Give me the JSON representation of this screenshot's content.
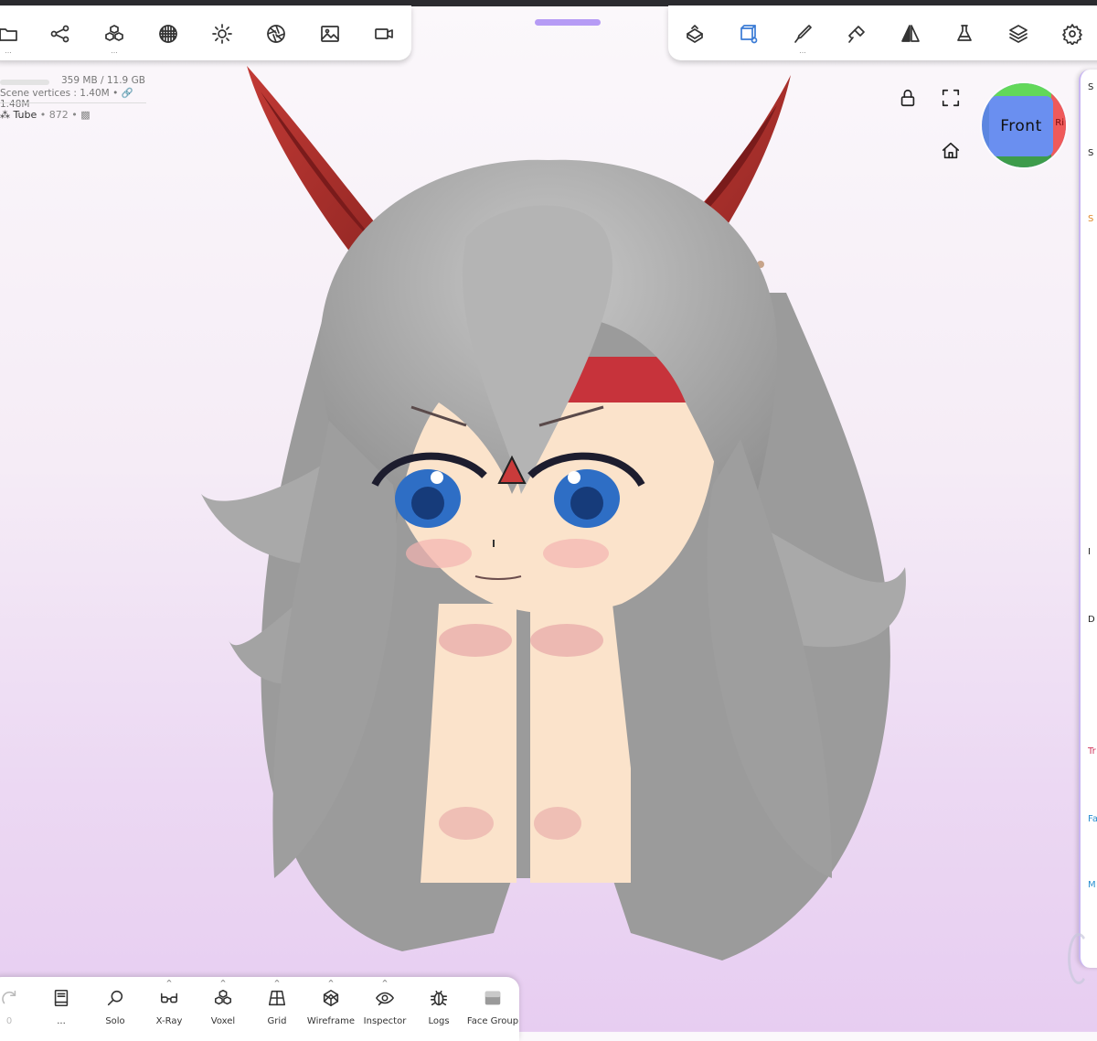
{
  "app": {
    "grabber": "drag-handle"
  },
  "left_toolbar": {
    "tools": [
      {
        "icon": "folder-icon",
        "more": "..."
      },
      {
        "icon": "share-nodes-icon",
        "more": ""
      },
      {
        "icon": "primitives-icon",
        "more": "..."
      },
      {
        "icon": "material-sphere-icon",
        "more": ""
      },
      {
        "icon": "light-icon",
        "more": ""
      },
      {
        "icon": "aperture-icon",
        "more": ""
      },
      {
        "icon": "image-icon",
        "more": ""
      },
      {
        "icon": "video-icon",
        "more": ""
      }
    ]
  },
  "right_toolbar": {
    "tools": [
      {
        "icon": "stamp-icon",
        "more": ""
      },
      {
        "icon": "select-cube-icon",
        "more": "",
        "active": true
      },
      {
        "icon": "brush-icon",
        "more": "..."
      },
      {
        "icon": "paint-brush-icon",
        "more": ""
      },
      {
        "icon": "symmetry-icon",
        "more": ""
      },
      {
        "icon": "flask-icon",
        "more": ""
      },
      {
        "icon": "layers-icon",
        "more": ""
      },
      {
        "icon": "settings-icon",
        "more": ""
      }
    ]
  },
  "stats": {
    "memory": "359 MB / 11.9 GB",
    "vertices": "Scene vertices :  1.40M • 🔗 1.48M",
    "object_name": "Tube",
    "object_meta": "• 872 •"
  },
  "viewport": {
    "gizmo_front": "Front",
    "gizmo_right": "Ri"
  },
  "right_panel": {
    "labels": [
      {
        "text": "S",
        "color": "#333333"
      },
      {
        "text": "S",
        "color": "#333333"
      },
      {
        "text": "S",
        "color": "#e08a2a"
      },
      {
        "text": "I",
        "color": "#333333"
      },
      {
        "text": "D",
        "color": "#333333"
      },
      {
        "text": "Tr",
        "color": "#d0345a"
      },
      {
        "text": "Fa",
        "color": "#2a8fd0"
      },
      {
        "text": "M",
        "color": "#2a8fd0"
      }
    ]
  },
  "bottom_toolbar": {
    "items": [
      {
        "icon": "redo-icon",
        "label": "0"
      },
      {
        "icon": "book-icon",
        "label": "..."
      },
      {
        "icon": "search-icon",
        "label": "Solo"
      },
      {
        "icon": "glasses-icon",
        "label": "X-Ray"
      },
      {
        "icon": "voxel-icon",
        "label": "Voxel"
      },
      {
        "icon": "grid-icon",
        "label": "Grid"
      },
      {
        "icon": "wireframe-icon",
        "label": "Wireframe"
      },
      {
        "icon": "eye-icon",
        "label": "Inspector"
      },
      {
        "icon": "bug-icon",
        "label": "Logs"
      },
      {
        "icon": "face-group-icon",
        "label": "Face Group"
      }
    ]
  },
  "colors": {
    "accent": "#b69bf5",
    "hair": "#a6a6a6",
    "ears": "#b0302c",
    "headband": "#c7333b",
    "skin": "#fbe3cb",
    "eyes": "#2e6ec5"
  }
}
